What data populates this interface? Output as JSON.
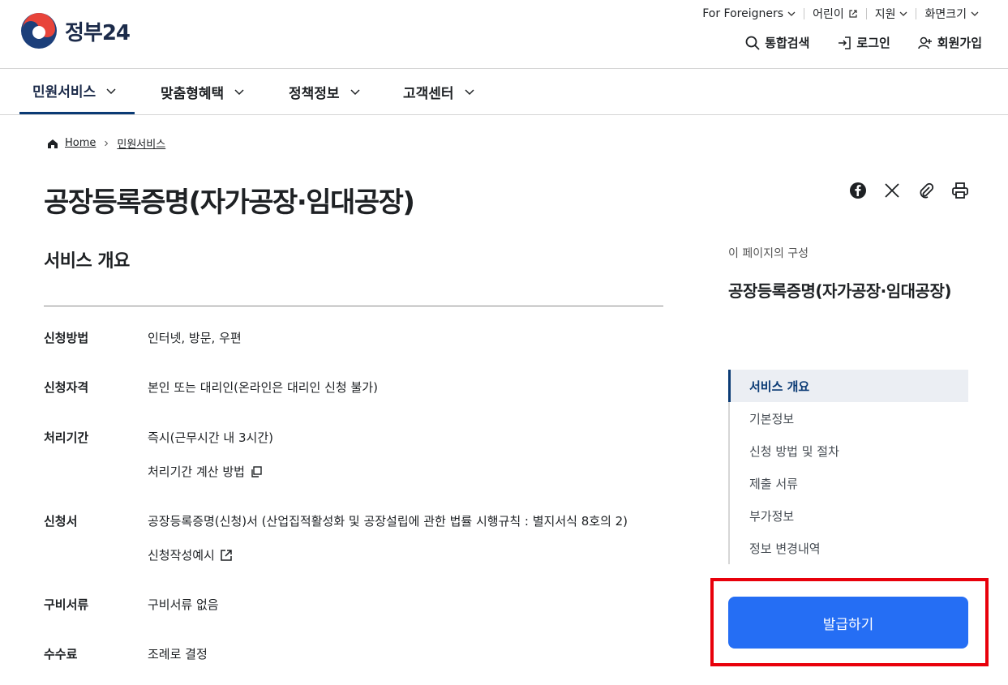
{
  "header": {
    "logo_text": "정부24",
    "util": [
      {
        "label": "For Foreigners"
      },
      {
        "label": "어린이"
      },
      {
        "label": "지원"
      },
      {
        "label": "화면크기"
      }
    ],
    "search_label": "통합검색",
    "login_label": "로그인",
    "join_label": "회원가입"
  },
  "nav": {
    "items": [
      {
        "label": "민원서비스"
      },
      {
        "label": "맞춤형혜택"
      },
      {
        "label": "정책정보"
      },
      {
        "label": "고객센터"
      }
    ]
  },
  "breadcrumb": {
    "home": "Home",
    "current": "민원서비스"
  },
  "page": {
    "title": "공장등록증명(자가공장·임대공장)",
    "section_title": "서비스 개요"
  },
  "details": {
    "rows": [
      {
        "label": "신청방법",
        "value": "인터넷, 방문, 우편"
      },
      {
        "label": "신청자격",
        "value": "본인 또는 대리인(온라인은 대리인 신청 불가)"
      },
      {
        "label": "처리기간",
        "value": "즉시(근무시간 내 3시간)",
        "link": "처리기간 계산 방법"
      },
      {
        "label": "신청서",
        "value": "공장등록증명(신청)서 (산업집적활성화 및 공장설립에 관한 법률 시행규칙 : 별지서식 8호의 2)",
        "link": "신청작성예시"
      },
      {
        "label": "구비서류",
        "value": "구비서류 없음"
      },
      {
        "label": "수수료",
        "value": "조례로 결정"
      }
    ]
  },
  "toc": {
    "caption": "이 페이지의 구성",
    "title": "공장등록증명(자가공장·임대공장)",
    "items": [
      {
        "label": "서비스 개요"
      },
      {
        "label": "기본정보"
      },
      {
        "label": "신청 방법 및 절차"
      },
      {
        "label": "제출 서류"
      },
      {
        "label": "부가정보"
      },
      {
        "label": "정보 변경내역"
      }
    ]
  },
  "cta": {
    "label": "발급하기"
  },
  "colors": {
    "primary_navy": "#0b3b75",
    "cta_blue": "#256ef4",
    "highlight_red": "#e8000b"
  }
}
